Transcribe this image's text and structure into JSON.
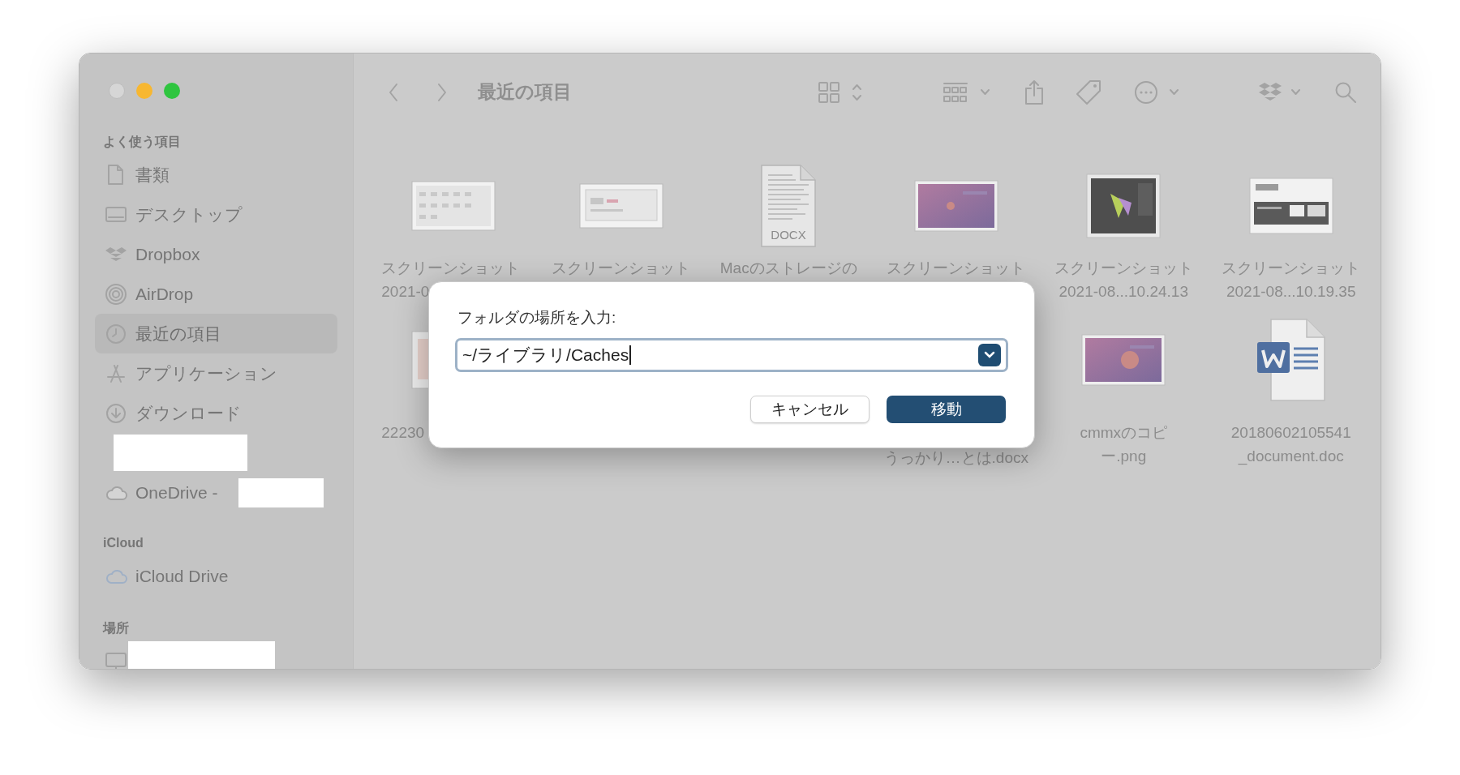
{
  "window": {
    "title": "最近の項目"
  },
  "sidebar": {
    "sections": [
      {
        "title": "よく使う項目",
        "items": [
          {
            "label": "書類",
            "selected": false,
            "redacted": false
          },
          {
            "label": "デスクトップ",
            "selected": false,
            "redacted": false
          },
          {
            "label": "Dropbox",
            "selected": false,
            "redacted": false
          },
          {
            "label": "AirDrop",
            "selected": false,
            "redacted": false
          },
          {
            "label": "最近の項目",
            "selected": true,
            "redacted": false
          },
          {
            "label": "アプリケーション",
            "selected": false,
            "redacted": false
          },
          {
            "label": "ダウンロード",
            "selected": false,
            "redacted": false
          },
          {
            "redacted": true
          },
          {
            "label": "OneDrive - ",
            "redacted": true
          }
        ]
      },
      {
        "title": "iCloud",
        "items": [
          {
            "label": "iCloud Drive",
            "selected": false,
            "redacted": false
          }
        ]
      },
      {
        "title": "場所",
        "items": [
          {
            "redacted": true
          }
        ]
      }
    ]
  },
  "files": [
    {
      "kind": "ui",
      "lines": [
        "スクリーンショット",
        "2021-0"
      ]
    },
    {
      "kind": "panel",
      "lines": [
        "スクリーンショット"
      ]
    },
    {
      "kind": "docx",
      "badge": "DOCX",
      "lines": [
        "Macのストレージの"
      ]
    },
    {
      "kind": "gradient",
      "lines": [
        "スクリーンショット"
      ]
    },
    {
      "kind": "dark",
      "lines": [
        "スクリーンショット",
        "2021-08...10.24.13"
      ]
    },
    {
      "kind": "mixed",
      "lines": [
        "スクリーンショット",
        "2021-08...10.19.35"
      ]
    },
    {
      "kind": "sketch",
      "lines": [
        "22230"
      ]
    },
    {
      "kind": "covered"
    },
    {
      "kind": "covered"
    },
    {
      "kind": "covered",
      "lines": [
        "うっかり…とは.docx"
      ]
    },
    {
      "kind": "gradient",
      "lines": [
        "cmmxのコピ",
        "ー.png"
      ]
    },
    {
      "kind": "word",
      "lines": [
        "20180602105541",
        "_document.doc"
      ]
    }
  ],
  "dialog": {
    "label": "フォルダの場所を入力:",
    "value": "~/ライブラリ/Caches",
    "buttons": [
      {
        "label": "キャンセル",
        "primary": false
      },
      {
        "label": "移動",
        "primary": true
      }
    ]
  }
}
